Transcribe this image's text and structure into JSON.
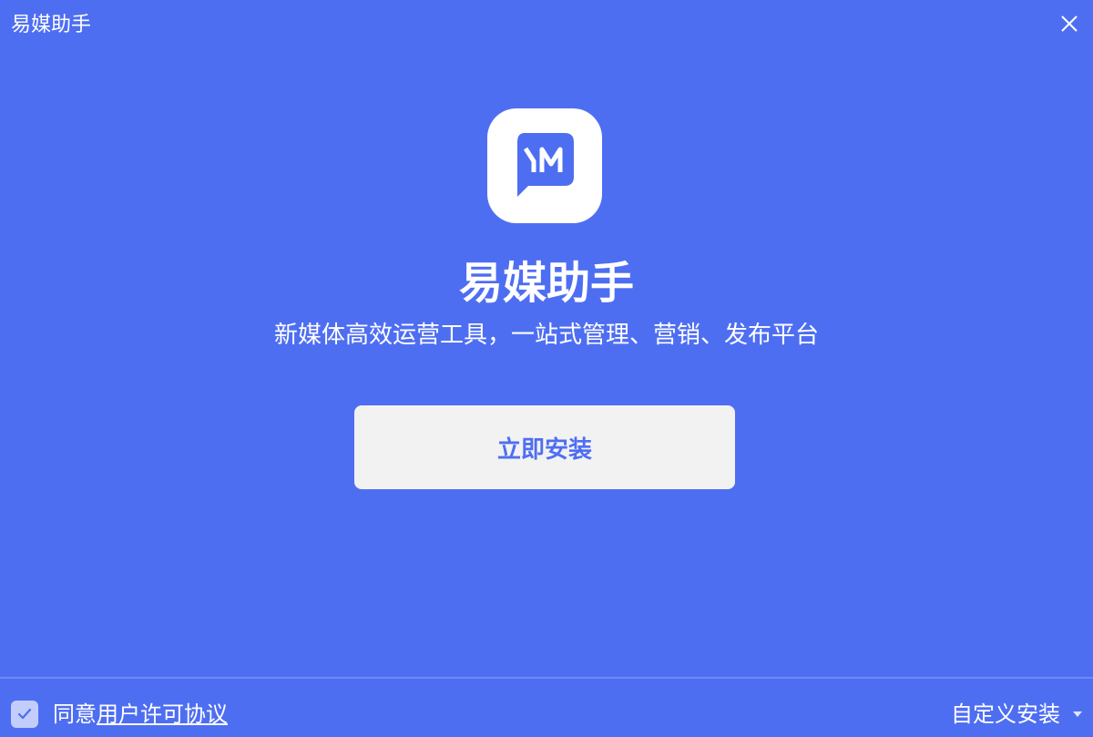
{
  "window": {
    "title": "易媒助手"
  },
  "app": {
    "name": "易媒助手",
    "tagline": "新媒体高效运营工具，一站式管理、营销、发布平台",
    "icon": "ym-logo-icon"
  },
  "actions": {
    "install_label": "立即安装",
    "custom_install_label": "自定义安装"
  },
  "footer": {
    "agree_prefix": "同意",
    "license_link": "用户许可协议",
    "agree_checked": true
  },
  "colors": {
    "background": "#4e6ef2",
    "button_bg": "#f2f2f2",
    "accent_text": "#4e6ef2",
    "checkbox_bg": "#c2cdfb"
  }
}
